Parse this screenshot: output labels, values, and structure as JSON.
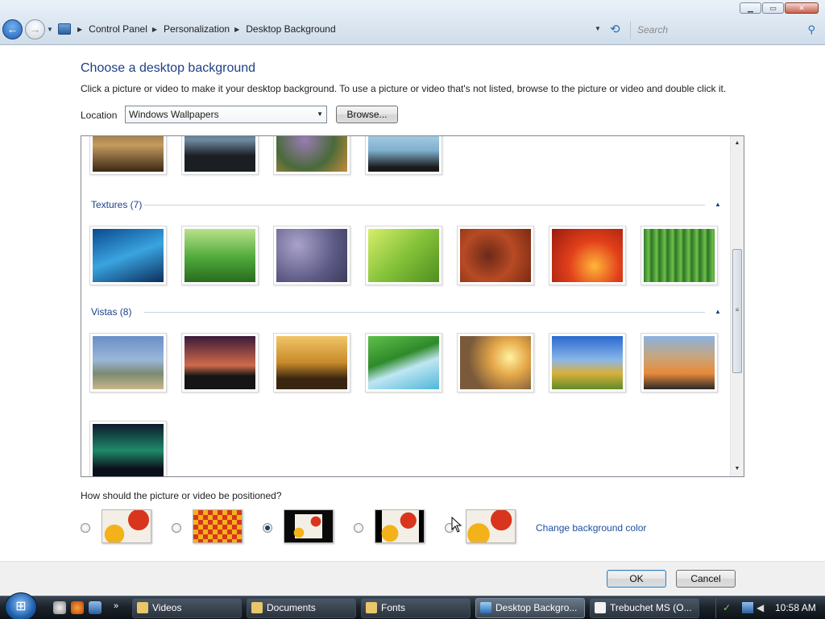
{
  "window": {
    "minimize": "▁",
    "maximize": "▭",
    "close": "✕"
  },
  "breadcrumb": [
    "Control Panel",
    "Personalization",
    "Desktop Background"
  ],
  "search": {
    "placeholder": "Search"
  },
  "main": {
    "title": "Choose a desktop background",
    "description": "Click a picture or video to make it your desktop background. To use a picture or video that's not listed, browse to the picture or video and double click it.",
    "location_label": "Location",
    "location_value": "Windows Wallpapers",
    "browse_label": "Browse..."
  },
  "gallery": {
    "groups": [
      {
        "label": "Textures (7)"
      },
      {
        "label": "Vistas (8)"
      }
    ]
  },
  "positioning": {
    "question": "How should the picture or video be positioned?",
    "options": [
      "fit-to-screen",
      "tile",
      "center",
      "center-black",
      "stretch"
    ],
    "selected": "center",
    "change_color_label": "Change background color"
  },
  "footer": {
    "ok_label": "OK",
    "cancel_label": "Cancel"
  },
  "taskbar": {
    "tasks": [
      {
        "label": "Videos"
      },
      {
        "label": "Documents"
      },
      {
        "label": "Fonts"
      },
      {
        "label": "Desktop Backgro..."
      },
      {
        "label": "Trebuchet MS (O..."
      }
    ],
    "active_task": "Desktop Backgro...",
    "clock": "10:58 AM"
  }
}
